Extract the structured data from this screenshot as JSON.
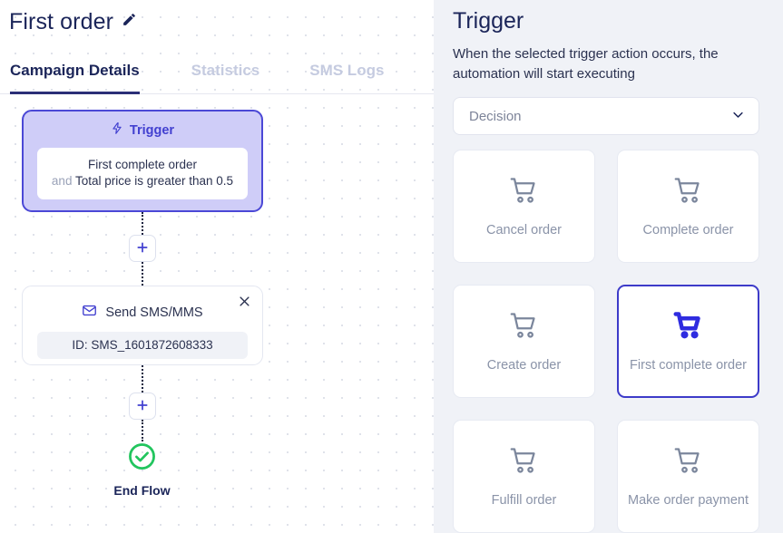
{
  "left": {
    "title": "First order",
    "edit_icon": "pencil-icon",
    "tabs": [
      {
        "label": "Campaign Details",
        "active": true
      },
      {
        "label": "Statistics",
        "active": false
      },
      {
        "label": "SMS Logs",
        "active": false
      }
    ],
    "flow": {
      "trigger": {
        "icon": "lightning-bolt-icon",
        "header": "Trigger",
        "line1": "First complete order",
        "conjunction": "and",
        "line2": "Total price is greater than 0.5"
      },
      "add_button_label": "+",
      "sms_node": {
        "icon": "envelope-icon",
        "title": "Send SMS/MMS",
        "id_label": "ID: SMS_1601872608333",
        "close_icon": "close-icon"
      },
      "end": {
        "icon": "check-circle-icon",
        "label": "End Flow"
      }
    }
  },
  "right": {
    "title": "Trigger",
    "description": "When the selected trigger action occurs, the automation will start executing",
    "select": {
      "value": "Decision",
      "chevron_icon": "chevron-down-icon"
    },
    "options": [
      {
        "label": "Cancel order",
        "icon": "shopping-cart-icon",
        "selected": false
      },
      {
        "label": "Complete order",
        "icon": "shopping-cart-icon",
        "selected": false
      },
      {
        "label": "Create order",
        "icon": "shopping-cart-icon",
        "selected": false
      },
      {
        "label": "First complete order",
        "icon": "shopping-cart-filled-icon",
        "selected": true
      },
      {
        "label": "Fulfill order",
        "icon": "shopping-cart-icon",
        "selected": false
      },
      {
        "label": "Make order payment",
        "icon": "shopping-cart-icon",
        "selected": false
      }
    ]
  },
  "colors": {
    "accent": "#4240d0",
    "trigger_fill": "#cfcdf8",
    "panel_bg": "#f0f2f7",
    "title": "#1b2559",
    "success": "#22c55e"
  }
}
